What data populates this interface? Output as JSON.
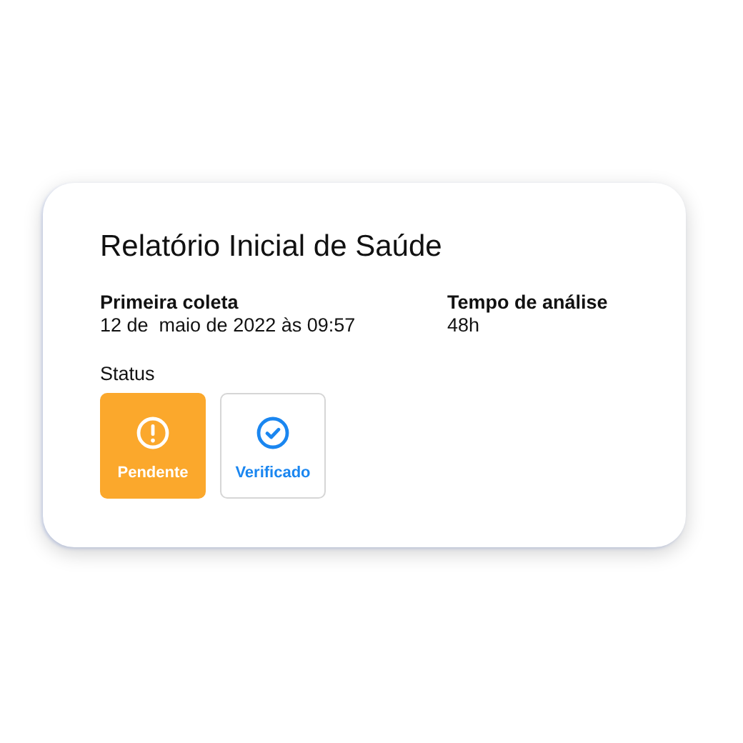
{
  "title": "Relatório Inicial de Saúde",
  "fields": [
    {
      "label": "Primeira coleta",
      "value": "12 de  maio de 2022 às 09:57"
    },
    {
      "label": "Tempo de análise",
      "value": "48h"
    }
  ],
  "status": {
    "label": "Status",
    "options": [
      {
        "label": "Pendente",
        "kind": "warning",
        "color": "#fba82c",
        "selected": true
      },
      {
        "label": "Verificado",
        "kind": "check",
        "color": "#1a86f0",
        "selected": false
      }
    ]
  }
}
